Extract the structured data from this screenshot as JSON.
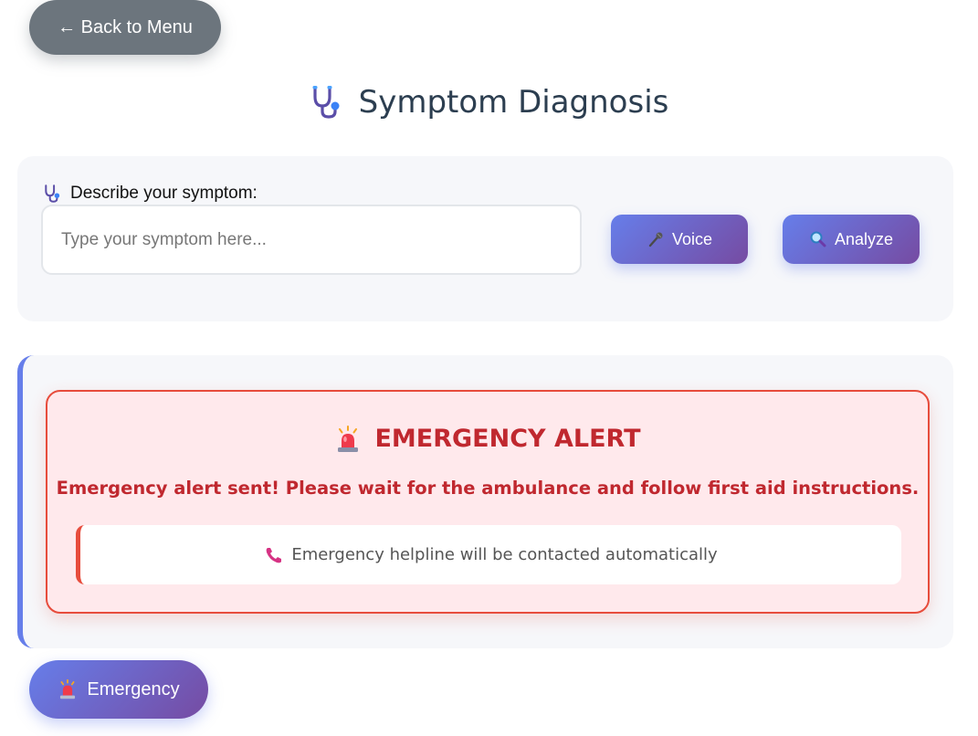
{
  "nav": {
    "back_label": "← Back to Menu"
  },
  "page": {
    "title": "Symptom Diagnosis",
    "title_icon": "stethoscope-icon"
  },
  "symptom_form": {
    "label": "Describe your symptom:",
    "label_icon": "stethoscope-icon",
    "input_value": "",
    "input_placeholder": "Type your symptom here...",
    "voice_label": "Voice",
    "voice_icon": "microphone-icon",
    "analyze_label": "Analyze",
    "analyze_icon": "magnifier-icon"
  },
  "alert": {
    "title": "EMERGENCY ALERT",
    "title_icon": "siren-icon",
    "message": "Emergency alert sent! Please wait for the ambulance and follow first aid instructions.",
    "helpline_text": "Emergency helpline will be contacted automatically",
    "helpline_icon": "phone-icon"
  },
  "footer": {
    "emergency_label": "Emergency",
    "emergency_icon": "siren-icon"
  },
  "colors": {
    "accent_gradient_start": "#667eea",
    "accent_gradient_end": "#764ba2",
    "back_button": "#6c757d",
    "alert_red": "#c0282f",
    "alert_border": "#e74c3c",
    "alert_bg": "#ffe9ec"
  }
}
